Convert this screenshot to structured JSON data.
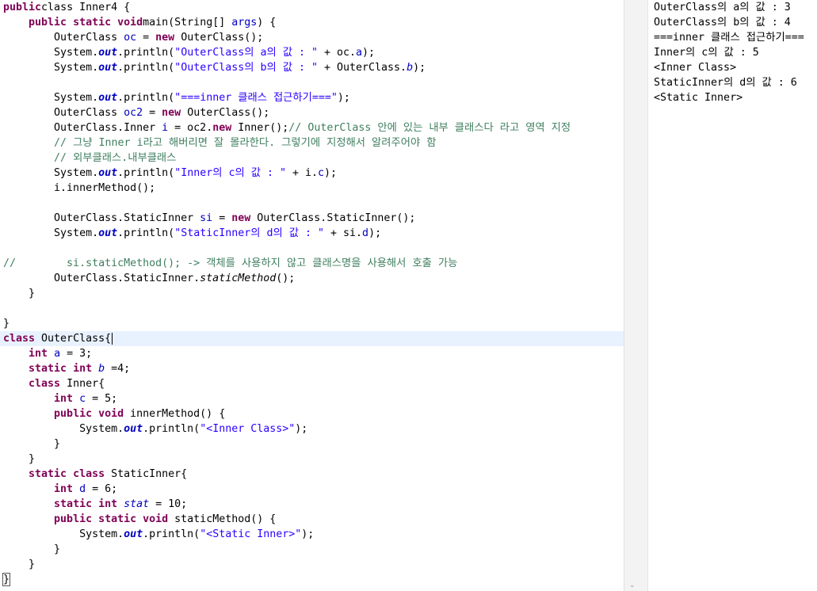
{
  "editor": {
    "lines": [
      [
        [
          "kw",
          "public"
        ],
        [
          "",
          "class Inner4 {"
        ]
      ],
      [
        [
          "",
          "    "
        ],
        [
          "kw",
          "public static void"
        ],
        [
          "",
          "main(String[] "
        ],
        [
          "fld",
          "args"
        ],
        [
          "",
          ") {"
        ]
      ],
      [
        [
          "",
          "        OuterClass "
        ],
        [
          "fld",
          "oc"
        ],
        [
          "",
          " = "
        ],
        [
          "kw",
          "new"
        ],
        [
          "",
          " OuterClass();"
        ]
      ],
      [
        [
          "",
          "        System."
        ],
        [
          "sfb",
          "out"
        ],
        [
          "",
          ".println("
        ],
        [
          "str",
          "\"OuterClass의 a의 값 : \""
        ],
        [
          "",
          " + oc."
        ],
        [
          "fld",
          "a"
        ],
        [
          "",
          ");"
        ]
      ],
      [
        [
          "",
          "        System."
        ],
        [
          "sfb",
          "out"
        ],
        [
          "",
          ".println("
        ],
        [
          "str",
          "\"OuterClass의 b의 값 : \""
        ],
        [
          "",
          " + OuterClass."
        ],
        [
          "sfld",
          "b"
        ],
        [
          "",
          ");"
        ]
      ],
      [],
      [
        [
          "",
          "        System."
        ],
        [
          "sfb",
          "out"
        ],
        [
          "",
          ".println("
        ],
        [
          "str",
          "\"===inner 클래스 접근하기===\""
        ],
        [
          "",
          ");"
        ]
      ],
      [
        [
          "",
          "        OuterClass "
        ],
        [
          "fld",
          "oc2"
        ],
        [
          "",
          " = "
        ],
        [
          "kw",
          "new"
        ],
        [
          "",
          " OuterClass();"
        ]
      ],
      [
        [
          "",
          "        OuterClass.Inner "
        ],
        [
          "fld",
          "i"
        ],
        [
          "",
          " = oc2."
        ],
        [
          "kw",
          "new"
        ],
        [
          "",
          " Inner();"
        ],
        [
          "cm",
          "// OuterClass 안에 있는 내부 클래스다 라고 영역 지정"
        ]
      ],
      [
        [
          "",
          "        "
        ],
        [
          "cm",
          "// 그냥 Inner i라고 해버리면 잘 몰라한다. 그렇기에 지정해서 알려주어야 함"
        ]
      ],
      [
        [
          "",
          "        "
        ],
        [
          "cm",
          "// 외부클래스.내부클래스"
        ]
      ],
      [
        [
          "",
          "        System."
        ],
        [
          "sfb",
          "out"
        ],
        [
          "",
          ".println("
        ],
        [
          "str",
          "\"Inner의 c의 값 : \""
        ],
        [
          "",
          " + i."
        ],
        [
          "fld",
          "c"
        ],
        [
          "",
          ");"
        ]
      ],
      [
        [
          "",
          "        i.innerMethod();"
        ]
      ],
      [],
      [
        [
          "",
          "        OuterClass.StaticInner "
        ],
        [
          "fld",
          "si"
        ],
        [
          "",
          " = "
        ],
        [
          "kw",
          "new"
        ],
        [
          "",
          " OuterClass.StaticInner();"
        ]
      ],
      [
        [
          "",
          "        System."
        ],
        [
          "sfb",
          "out"
        ],
        [
          "",
          ".println("
        ],
        [
          "str",
          "\"StaticInner의 d의 값 : \""
        ],
        [
          "",
          " + si."
        ],
        [
          "fld",
          "d"
        ],
        [
          "",
          ");"
        ]
      ],
      [],
      [
        [
          "cm",
          "//        si.staticMethod(); -> 객체를 사용하지 않고 클래스명을 사용해서 호출 가능"
        ]
      ],
      [
        [
          "",
          "        OuterClass.StaticInner."
        ],
        [
          "sm",
          "staticMethod"
        ],
        [
          "",
          "();"
        ]
      ],
      [
        [
          "",
          "    }"
        ]
      ],
      [],
      [
        [
          "",
          "}"
        ]
      ],
      [
        [
          "kw",
          "class"
        ],
        [
          "",
          " OuterClass{"
        ],
        [
          "caret",
          ""
        ]
      ],
      [
        [
          "",
          "    "
        ],
        [
          "kw",
          "int"
        ],
        [
          "",
          " "
        ],
        [
          "fld",
          "a"
        ],
        [
          "",
          " = 3;"
        ]
      ],
      [
        [
          "",
          "    "
        ],
        [
          "kw",
          "static int"
        ],
        [
          "",
          " "
        ],
        [
          "sfld",
          "b"
        ],
        [
          "",
          " =4;"
        ]
      ],
      [
        [
          "",
          "    "
        ],
        [
          "kw",
          "class"
        ],
        [
          "",
          " Inner{"
        ]
      ],
      [
        [
          "",
          "        "
        ],
        [
          "kw",
          "int"
        ],
        [
          "",
          " "
        ],
        [
          "fld",
          "c"
        ],
        [
          "",
          " = 5;"
        ]
      ],
      [
        [
          "",
          "        "
        ],
        [
          "kw",
          "public void"
        ],
        [
          "",
          " innerMethod() {"
        ]
      ],
      [
        [
          "",
          "            System."
        ],
        [
          "sfb",
          "out"
        ],
        [
          "",
          ".println("
        ],
        [
          "str",
          "\"<Inner Class>\""
        ],
        [
          "",
          ");"
        ]
      ],
      [
        [
          "",
          "        }"
        ]
      ],
      [
        [
          "",
          "    }"
        ]
      ],
      [
        [
          "",
          "    "
        ],
        [
          "kw",
          "static class"
        ],
        [
          "",
          " StaticInner{"
        ]
      ],
      [
        [
          "",
          "        "
        ],
        [
          "kw",
          "int"
        ],
        [
          "",
          " "
        ],
        [
          "fld",
          "d"
        ],
        [
          "",
          " = 6;"
        ]
      ],
      [
        [
          "",
          "        "
        ],
        [
          "kw",
          "static int"
        ],
        [
          "",
          " "
        ],
        [
          "sfld",
          "stat"
        ],
        [
          "",
          " = 10;"
        ]
      ],
      [
        [
          "",
          "        "
        ],
        [
          "kw",
          "public static void"
        ],
        [
          "",
          " staticMethod() {"
        ]
      ],
      [
        [
          "",
          "            System."
        ],
        [
          "sfb",
          "out"
        ],
        [
          "",
          ".println("
        ],
        [
          "str",
          "\"<Static Inner>\""
        ],
        [
          "",
          ");"
        ]
      ],
      [
        [
          "",
          "        }"
        ]
      ],
      [
        [
          "",
          "    }"
        ]
      ],
      [
        [
          "br",
          "}"
        ]
      ]
    ]
  },
  "console": {
    "lines": [
      "OuterClass의 a의 값 : 3",
      "OuterClass의 b의 값 : 4",
      "===inner 클래스 접근하기===",
      "Inner의 c의 값 : 5",
      "<Inner Class>",
      "StaticInner의 d의 값 : 6",
      "<Static Inner>"
    ]
  },
  "icons": {
    "scroll_down": "chevron-down-icon"
  },
  "colors": {
    "keyword": "#7f0055",
    "string": "#2a00ff",
    "comment": "#3f7f5f",
    "field": "#0000c0",
    "current_line": "#e8f2fe"
  }
}
